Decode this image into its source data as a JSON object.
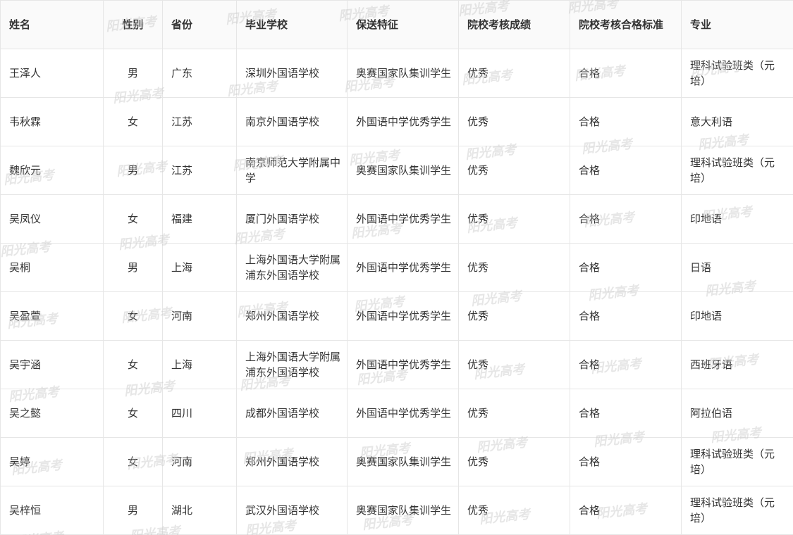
{
  "watermark": "阳光高考",
  "table": {
    "headers": [
      "姓名",
      "性别",
      "省份",
      "毕业学校",
      "保送特征",
      "院校考核成绩",
      "院校考核合格标准",
      "专业"
    ],
    "rows": [
      [
        "王泽人",
        "男",
        "广东",
        "深圳外国语学校",
        "奥赛国家队集训学生",
        "优秀",
        "合格",
        "理科试验班类（元培）"
      ],
      [
        "韦秋霖",
        "女",
        "江苏",
        "南京外国语学校",
        "外国语中学优秀学生",
        "优秀",
        "合格",
        "意大利语"
      ],
      [
        "魏欣元",
        "男",
        "江苏",
        "南京师范大学附属中学",
        "奥赛国家队集训学生",
        "优秀",
        "合格",
        "理科试验班类（元培）"
      ],
      [
        "吴凤仪",
        "女",
        "福建",
        "厦门外国语学校",
        "外国语中学优秀学生",
        "优秀",
        "合格",
        "印地语"
      ],
      [
        "吴桐",
        "男",
        "上海",
        "上海外国语大学附属浦东外国语学校",
        "外国语中学优秀学生",
        "优秀",
        "合格",
        "日语"
      ],
      [
        "吴盈萱",
        "女",
        "河南",
        "郑州外国语学校",
        "外国语中学优秀学生",
        "优秀",
        "合格",
        "印地语"
      ],
      [
        "吴宇涵",
        "女",
        "上海",
        "上海外国语大学附属浦东外国语学校",
        "外国语中学优秀学生",
        "优秀",
        "合格",
        "西班牙语"
      ],
      [
        "吴之懿",
        "女",
        "四川",
        "成都外国语学校",
        "外国语中学优秀学生",
        "优秀",
        "合格",
        "阿拉伯语"
      ],
      [
        "吴婷",
        "女",
        "河南",
        "郑州外国语学校",
        "奥赛国家队集训学生",
        "优秀",
        "合格",
        "理科试验班类（元培）"
      ],
      [
        "吴梓恒",
        "男",
        "湖北",
        "武汉外国语学校",
        "奥赛国家队集训学生",
        "优秀",
        "合格",
        "理科试验班类（元培）"
      ]
    ]
  }
}
